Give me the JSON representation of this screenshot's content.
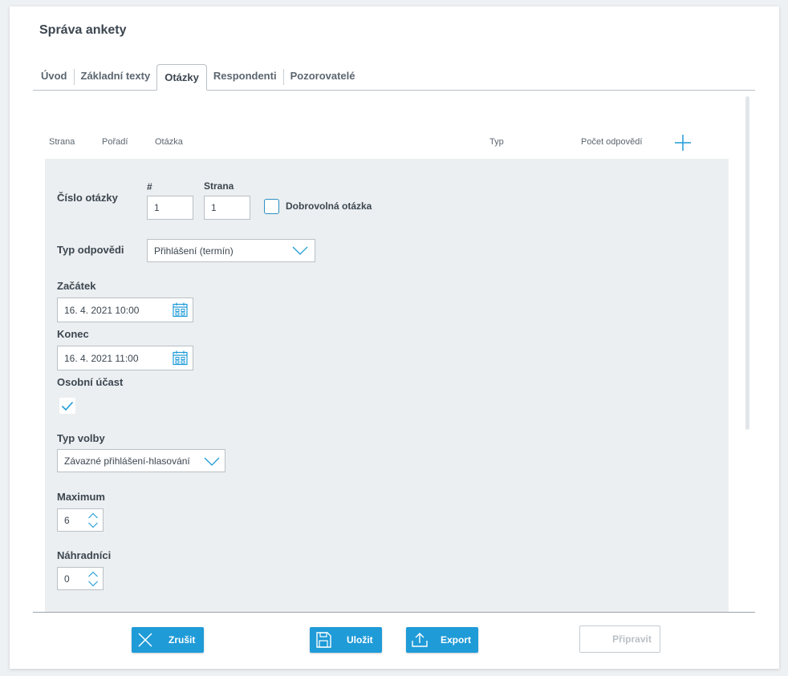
{
  "page": {
    "title": "Správa ankety"
  },
  "tabs": [
    {
      "label": "Úvod",
      "active": false
    },
    {
      "label": "Základní texty",
      "active": false
    },
    {
      "label": "Otázky",
      "active": true
    },
    {
      "label": "Respondenti",
      "active": false
    },
    {
      "label": "Pozorovatelé",
      "active": false
    }
  ],
  "table": {
    "columns": [
      "Strana",
      "Pořadí",
      "Otázka",
      "Typ",
      "Počet odpovědí"
    ],
    "add_icon": "plus-icon"
  },
  "question": {
    "number_label": "Číslo otázky",
    "hash_label": "#",
    "hash_value": "1",
    "page_label": "Strana",
    "page_value": "1",
    "optional_label": "Dobrovolná otázka",
    "optional_checked": false,
    "answer_type_label": "Typ odpovědi",
    "answer_type_value": "Přihlášení (termín)",
    "start_label": "Začátek",
    "start_value": "16. 4. 2021 10:00",
    "end_label": "Konec",
    "end_value": "16. 4. 2021 11:00",
    "personal_label": "Osobní účast",
    "personal_checked": true,
    "choice_type_label": "Typ volby",
    "choice_type_value": "Závazné přihlášení-hlasování",
    "maximum_label": "Maximum",
    "maximum_value": "6",
    "substitutes_label": "Náhradníci",
    "substitutes_value": "0"
  },
  "footer": {
    "cancel_label": "Zrušit",
    "save_label": "Uložit",
    "export_label": "Export",
    "prepare_label": "Připravit"
  },
  "colors": {
    "accent": "#1f9bd7",
    "panel_bg": "#eceff1"
  }
}
